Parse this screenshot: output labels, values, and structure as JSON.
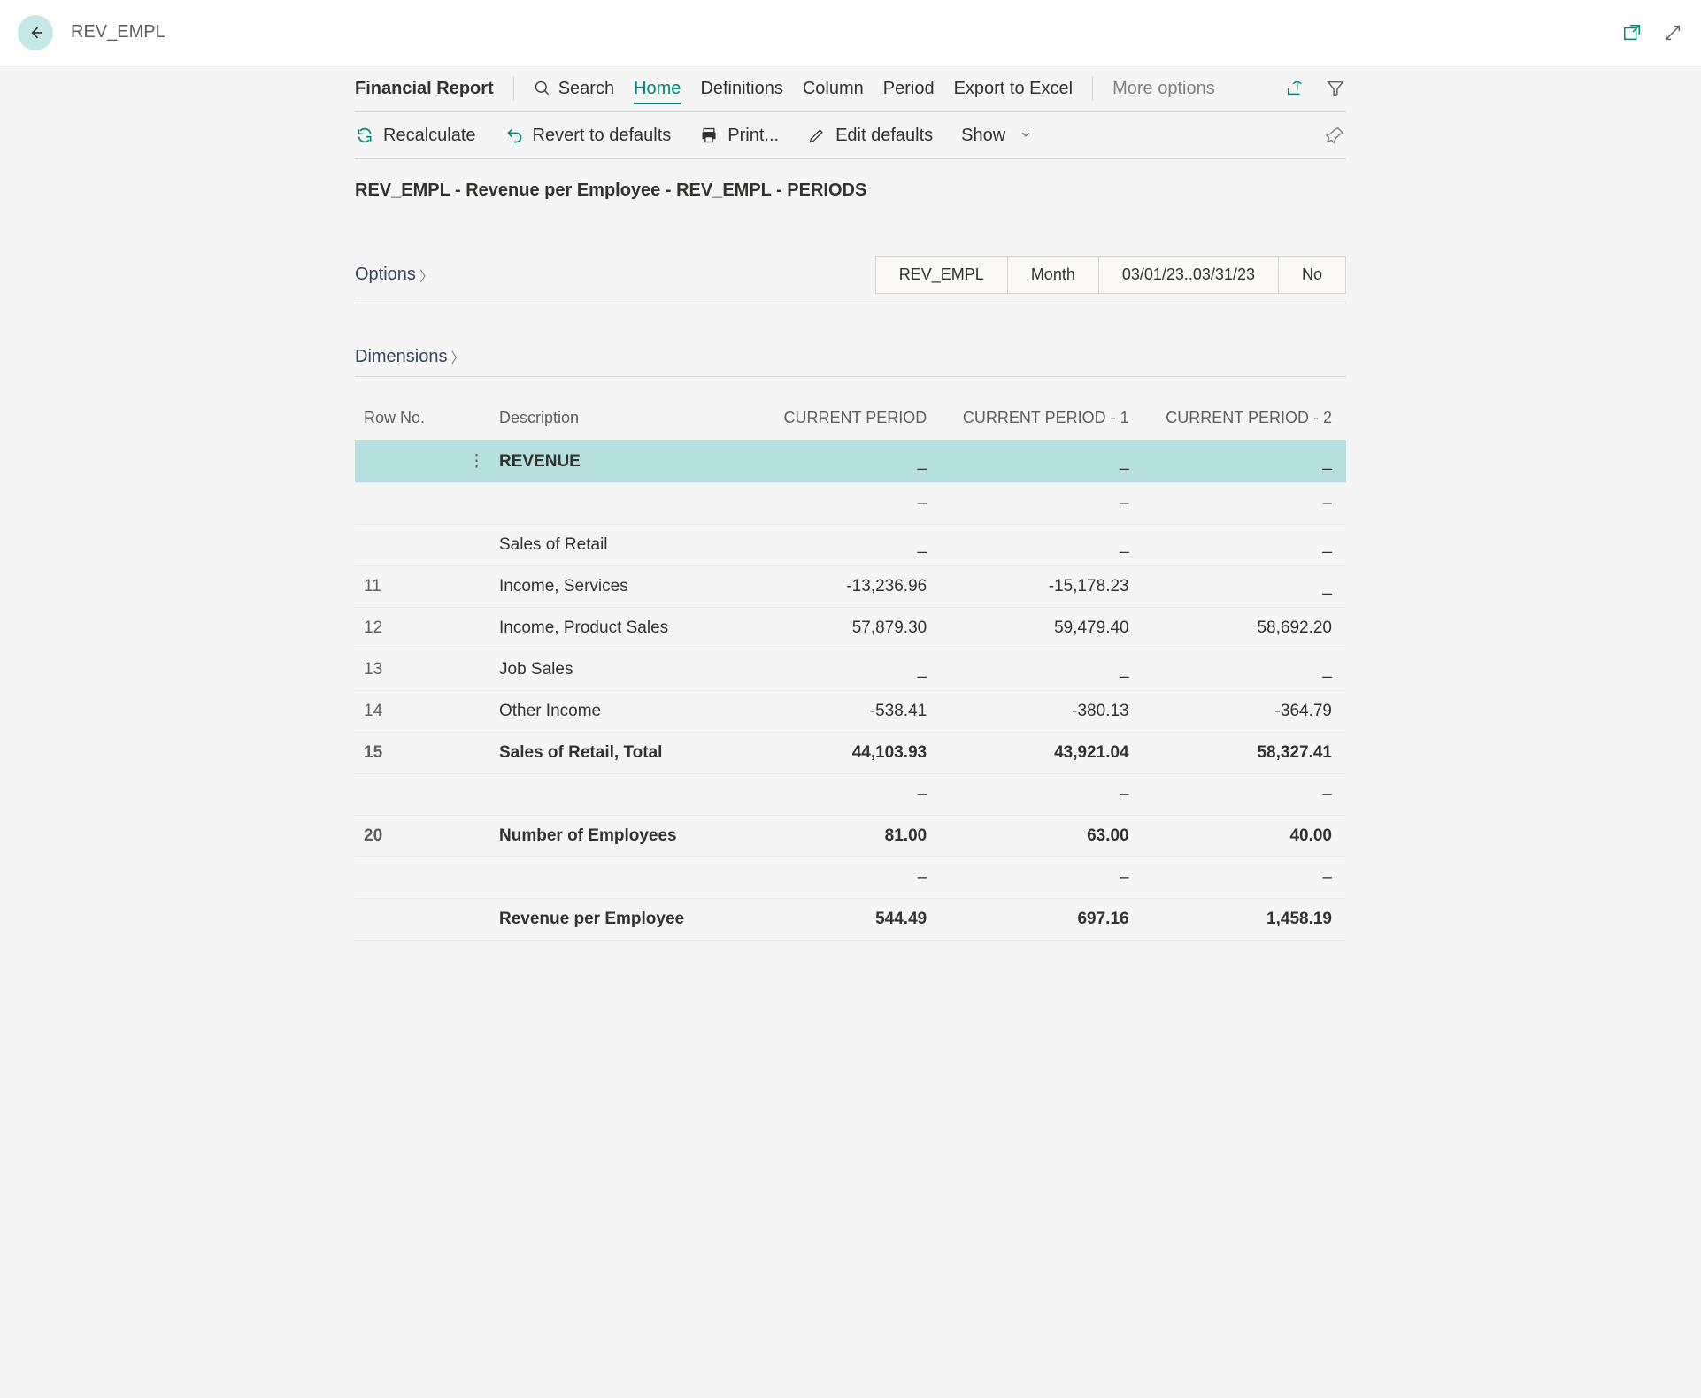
{
  "title": "REV_EMPL",
  "menu": {
    "report_title": "Financial Report",
    "search": "Search",
    "home": "Home",
    "definitions": "Definitions",
    "column": "Column",
    "period": "Period",
    "export": "Export to Excel",
    "more": "More options"
  },
  "toolbar": {
    "recalculate": "Recalculate",
    "revert": "Revert to defaults",
    "print": "Print...",
    "edit_defaults": "Edit defaults",
    "show": "Show"
  },
  "description": "REV_EMPL - Revenue per Employee - REV_EMPL - PERIODS",
  "sections": {
    "options_label": "Options",
    "dimensions_label": "Dimensions"
  },
  "option_boxes": [
    "REV_EMPL",
    "Month",
    "03/01/23..03/31/23",
    "No"
  ],
  "table": {
    "headers": [
      "Row No.",
      "Description",
      "CURRENT PERIOD",
      "CURRENT PERIOD - 1",
      "CURRENT PERIOD - 2"
    ],
    "rows": [
      {
        "rowno": "",
        "desc": "REVENUE",
        "v0": "_",
        "v1": "_",
        "v2": "_",
        "highlight": true,
        "menu": true
      },
      {
        "rowno": "",
        "desc": "",
        "v0": "–",
        "v1": "–",
        "v2": "–"
      },
      {
        "rowno": "",
        "desc": "Sales of Retail",
        "v0": "_",
        "v1": "_",
        "v2": "_"
      },
      {
        "rowno": "11",
        "desc": "Income, Services",
        "v0": "-13,236.96",
        "v1": "-15,178.23",
        "v2": "_"
      },
      {
        "rowno": "12",
        "desc": "Income, Product Sales",
        "v0": "57,879.30",
        "v1": "59,479.40",
        "v2": "58,692.20"
      },
      {
        "rowno": "13",
        "desc": "Job Sales",
        "v0": "_",
        "v1": "_",
        "v2": "_"
      },
      {
        "rowno": "14",
        "desc": "Other Income",
        "v0": "-538.41",
        "v1": "-380.13",
        "v2": "-364.79"
      },
      {
        "rowno": "15",
        "desc": "Sales of Retail, Total",
        "v0": "44,103.93",
        "v1": "43,921.04",
        "v2": "58,327.41",
        "bold": true
      },
      {
        "rowno": "",
        "desc": "",
        "v0": "–",
        "v1": "–",
        "v2": "–"
      },
      {
        "rowno": "20",
        "desc": "Number of Employees",
        "v0": "81.00",
        "v1": "63.00",
        "v2": "40.00",
        "bold": true
      },
      {
        "rowno": "",
        "desc": "",
        "v0": "–",
        "v1": "–",
        "v2": "–"
      },
      {
        "rowno": "",
        "desc": "Revenue per Employee",
        "v0": "544.49",
        "v1": "697.16",
        "v2": "1,458.19",
        "bold": true
      }
    ]
  }
}
